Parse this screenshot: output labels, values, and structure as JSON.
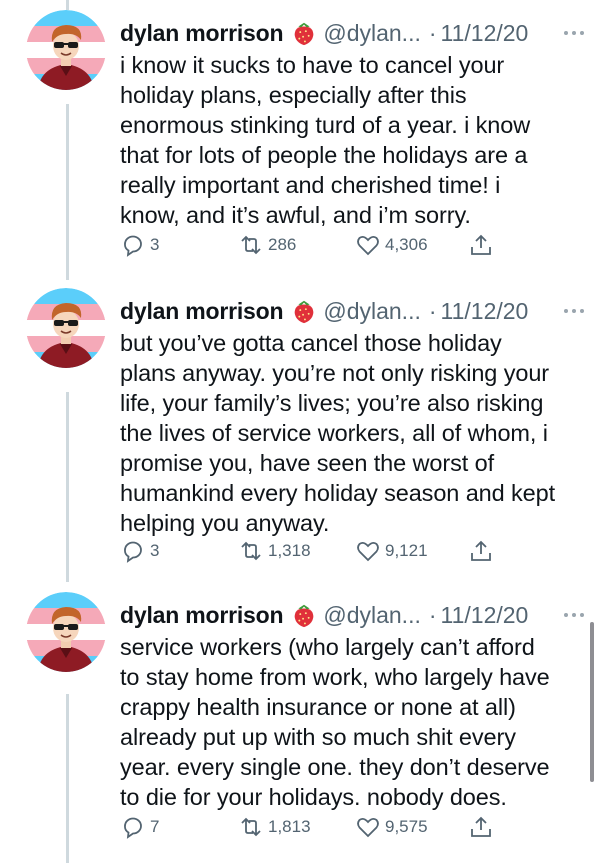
{
  "thread": {
    "tweets": [
      {
        "author": "dylan morrison",
        "handle": "@dylan...",
        "separator": "·",
        "date": "11/12/20",
        "emoji_icon": "strawberry-icon",
        "lines": [
          "i know it sucks to have to cancel your",
          "holiday plans, especially after this",
          "enormous stinking turd of a year. i know",
          "that for lots of people the holidays are a",
          "really important and cherished time! i",
          "know, and it’s awful, and i’m sorry."
        ],
        "replies": "3",
        "retweets": "286",
        "likes": "4,306"
      },
      {
        "author": "dylan morrison",
        "handle": "@dylan...",
        "separator": "·",
        "date": "11/12/20",
        "emoji_icon": "strawberry-icon",
        "lines": [
          "but you’ve gotta cancel those holiday",
          "plans anyway. you’re not only risking your",
          "life, your family’s lives; you’re also risking",
          "the lives of service workers, all of whom, i",
          "promise you, have seen the worst of",
          "humankind every holiday season and kept",
          "helping you anyway."
        ],
        "replies": "3",
        "retweets": "1,318",
        "likes": "9,121"
      },
      {
        "author": "dylan morrison",
        "handle": "@dylan...",
        "separator": "·",
        "date": "11/12/20",
        "emoji_icon": "strawberry-icon",
        "lines": [
          "service workers (who largely can’t afford",
          "to stay home from work, who largely have",
          "crappy health insurance or none at all)",
          "already put up with so much shit every",
          "year. every single one. they don’t deserve",
          "to die for your holidays. nobody does."
        ],
        "replies": "7",
        "retweets": "1,813",
        "likes": "9,575"
      }
    ]
  },
  "colors": {
    "text": "#0f1419",
    "secondary": "#536471",
    "thread_line": "#cfd9de",
    "trans_blue": "#5bcefa",
    "trans_pink": "#f5a9b8"
  },
  "icons": [
    "reply-icon",
    "retweet-icon",
    "like-icon",
    "share-icon",
    "more-icon",
    "strawberry-icon"
  ]
}
